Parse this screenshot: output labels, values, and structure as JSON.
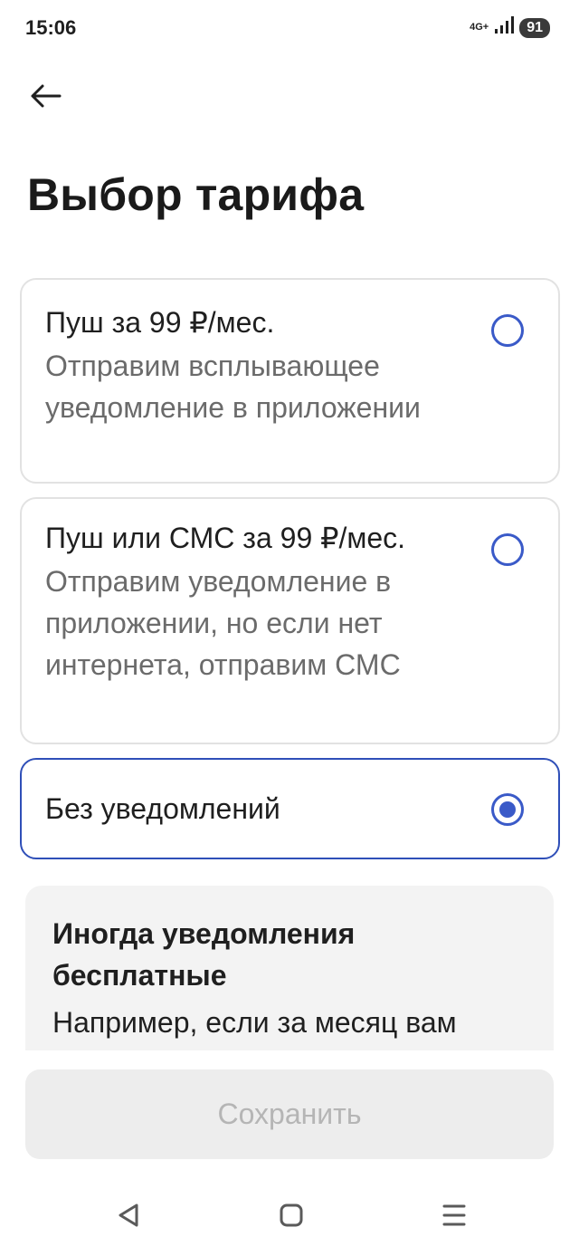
{
  "status_bar": {
    "time": "15:06",
    "network": "4G+",
    "battery": "91"
  },
  "header": {
    "back_icon": "arrow-left-icon",
    "title": "Выбор тарифа"
  },
  "options": [
    {
      "title": "Пуш за 99 ₽/мес.",
      "description": "Отправим всплывающее уведомление в приложении",
      "selected": false
    },
    {
      "title": "Пуш или СМС за 99 ₽/мес.",
      "description": "Отправим уведомление в приложении, но если нет интернета, отправим СМС",
      "selected": false
    },
    {
      "title": "Без уведомлений",
      "description": "",
      "selected": true
    }
  ],
  "info": {
    "title": "Иногда уведомления бесплатные",
    "text": "Например, если за месяц вам"
  },
  "save_button": {
    "label": "Сохранить"
  },
  "colors": {
    "accent": "#3a5ac8",
    "card_border": "#e2e2e2",
    "selected_border": "#2f4fb8",
    "muted_text": "#6b6b6b",
    "disabled_button_bg": "#ededed",
    "disabled_button_text": "#b5b5b5"
  }
}
